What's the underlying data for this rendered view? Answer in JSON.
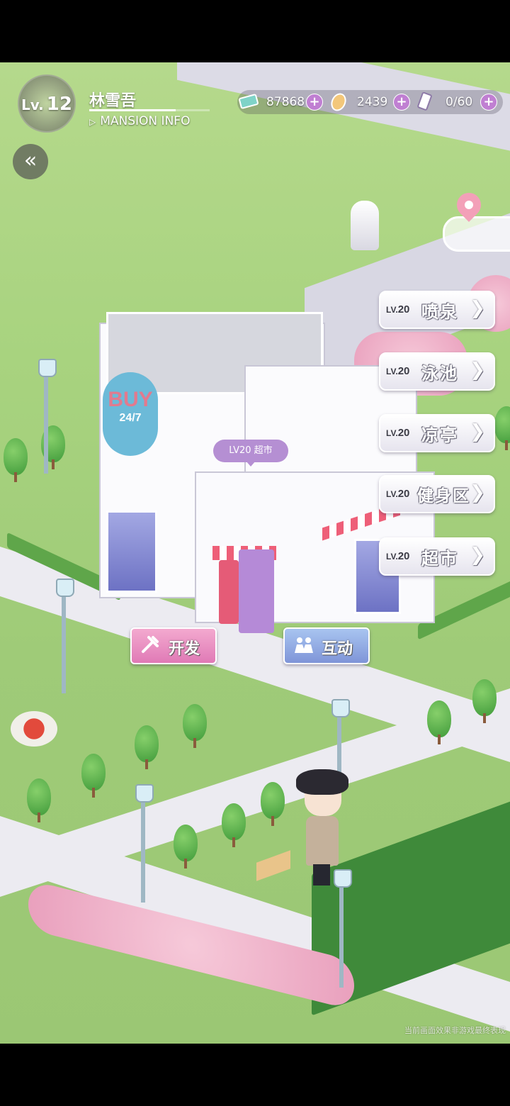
{
  "player": {
    "level_prefix": "Lv.",
    "level": "12",
    "name": "林雪吾",
    "mansion_info": "MANSION INFO",
    "exp_progress": 0.72
  },
  "currencies": [
    {
      "icon": "cash-icon",
      "value": "87868"
    },
    {
      "icon": "gem-icon",
      "value": "2439"
    },
    {
      "icon": "energy-drink-icon",
      "value": "0/60"
    }
  ],
  "plus_label": "+",
  "back_label": "«",
  "building_tag": "LV20 超市",
  "buy_sign": {
    "main": "BUY",
    "sub": "24/7"
  },
  "facilities": [
    {
      "lv_prefix": "LV.",
      "lv": "20",
      "name": "喷泉",
      "arrow": "❯"
    },
    {
      "lv_prefix": "LV.",
      "lv": "20",
      "name": "泳池",
      "arrow": "❯"
    },
    {
      "lv_prefix": "LV.",
      "lv": "20",
      "name": "凉亭",
      "arrow": "❯"
    },
    {
      "lv_prefix": "LV.",
      "lv": "20",
      "name": "健身区",
      "arrow": "❯"
    },
    {
      "lv_prefix": "LV.",
      "lv": "20",
      "name": "超市",
      "arrow": "❯"
    }
  ],
  "actions": {
    "develop": {
      "label": "开发",
      "icon": "tools-icon"
    },
    "interact": {
      "label": "互动",
      "icon": "people-icon"
    }
  },
  "disclaimer": "当前画面效果非游戏最终表现",
  "colors": {
    "accent": "#c07fd2",
    "develop": "#e07ab6",
    "interact": "#7f95d8"
  }
}
